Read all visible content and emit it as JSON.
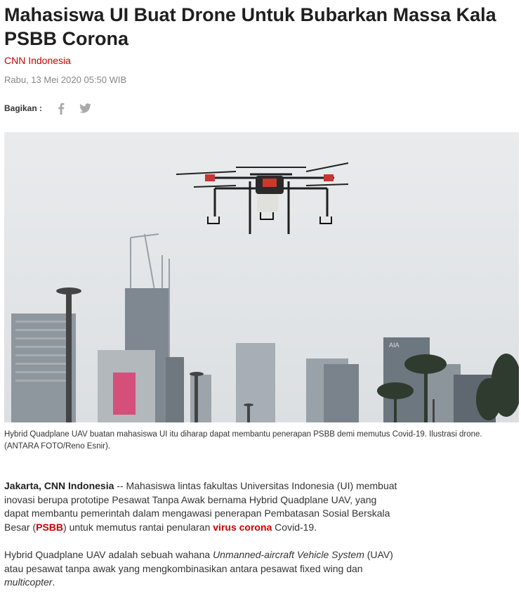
{
  "article": {
    "title": "Mahasiswa UI Buat Drone Untuk Bubarkan Massa Kala PSBB Corona",
    "source": "CNN Indonesia",
    "date": "Rabu, 13 Mei 2020 05:50 WIB"
  },
  "share": {
    "label": "Bagikan :",
    "icons": [
      "facebook-icon",
      "twitter-icon"
    ]
  },
  "photo": {
    "caption": "Hybrid Quadplane UAV buatan mahasiswa UI itu diharap dapat membantu penerapan PSBB demi memutus Covid-19. Ilustrasi drone. (ANTARA FOTO/Reno Esnir)."
  },
  "body": {
    "p1": {
      "dateline": "Jakarta, CNN Indonesia",
      "text1": " -- Mahasiswa lintas fakultas Universitas Indonesia (UI) membuat inovasi berupa prototipe Pesawat Tanpa Awak bernama Hybrid Quadplane UAV, yang dapat membantu pemerintah dalam mengawasi penerapan Pembatasan Sosial Berskala Besar (",
      "link1": "PSBB",
      "text2": ") untuk memutus rantai penularan ",
      "link2": "virus corona",
      "text3": " Covid-19."
    },
    "p2": {
      "text1": "Hybrid Quadplane UAV adalah sebuah wahana ",
      "em1": "Unmanned-aircraft Vehicle System",
      "text2": " (UAV) atau pesawat tanpa awak yang mengkombinasikan antara pesawat fixed wing dan ",
      "em2": "multicopter",
      "text3": "."
    }
  },
  "colors": {
    "accent": "#cc0000",
    "muted": "#888888",
    "sky": "#e6e8ea"
  }
}
